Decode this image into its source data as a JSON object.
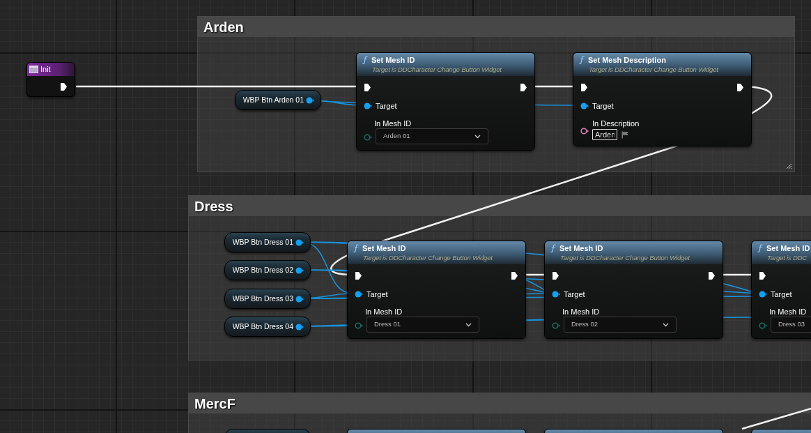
{
  "event_node": {
    "title": "Init"
  },
  "comments": [
    {
      "title": "Arden"
    },
    {
      "title": "Dress"
    },
    {
      "title": "MercF"
    }
  ],
  "variables": [
    {
      "label": "WBP Btn Arden 01"
    },
    {
      "label": "WBP Btn Dress 01"
    },
    {
      "label": "WBP Btn Dress 02"
    },
    {
      "label": "WBP Btn Dress 03"
    },
    {
      "label": "WBP Btn Dress 04"
    }
  ],
  "function_nodes": [
    {
      "title": "Set Mesh ID",
      "subtitle": "Target is DDCharacter Change Button Widget",
      "pins": [
        {
          "kind": "target",
          "label": "Target"
        },
        {
          "kind": "dropdown",
          "label": "In Mesh ID",
          "value": "Arden 01"
        }
      ]
    },
    {
      "title": "Set Mesh Description",
      "subtitle": "Target is DDCharacter Change Button Widget",
      "pins": [
        {
          "kind": "target",
          "label": "Target"
        },
        {
          "kind": "text",
          "label": "In Description",
          "value": "Arden"
        }
      ]
    },
    {
      "title": "Set Mesh ID",
      "subtitle": "Target is DDCharacter Change Button Widget",
      "pins": [
        {
          "kind": "target",
          "label": "Target"
        },
        {
          "kind": "dropdown",
          "label": "In Mesh ID",
          "value": "Dress 01"
        }
      ]
    },
    {
      "title": "Set Mesh ID",
      "subtitle": "Target is DDCharacter Change Button Widget",
      "pins": [
        {
          "kind": "target",
          "label": "Target"
        },
        {
          "kind": "dropdown",
          "label": "In Mesh ID",
          "value": "Dress 02"
        }
      ]
    },
    {
      "title": "Set Mesh ID",
      "subtitle": "Target is DDC",
      "pins": [
        {
          "kind": "target",
          "label": "Target"
        },
        {
          "kind": "dropdown",
          "label": "In Mesh ID",
          "value": "Dress 03"
        }
      ]
    }
  ]
}
